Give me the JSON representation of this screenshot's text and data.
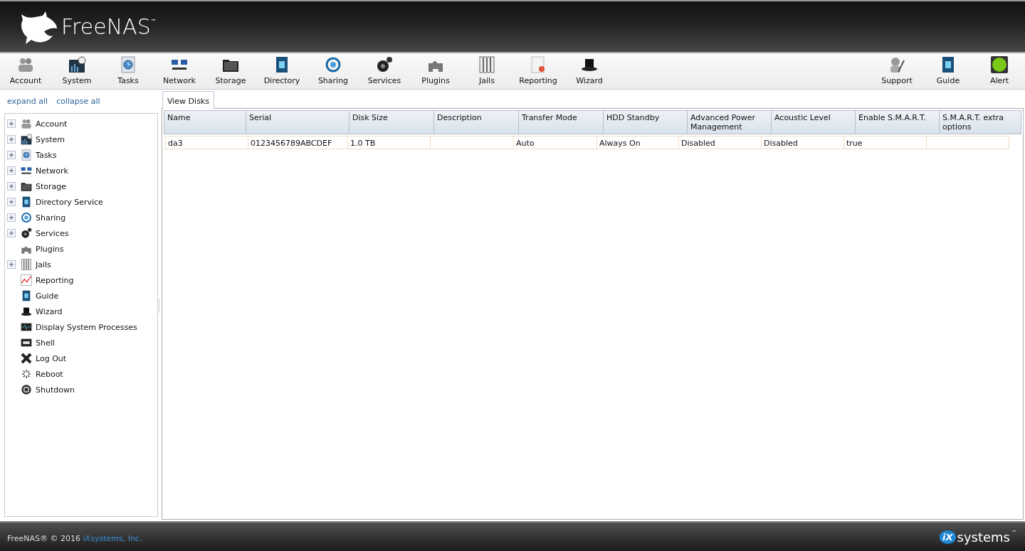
{
  "header": {
    "logo_text": "FreeNAS",
    "logo_mark": "™"
  },
  "toolbar": {
    "left": [
      {
        "label": "Account"
      },
      {
        "label": "System"
      },
      {
        "label": "Tasks"
      },
      {
        "label": "Network"
      },
      {
        "label": "Storage"
      },
      {
        "label": "Directory"
      },
      {
        "label": "Sharing"
      },
      {
        "label": "Services"
      },
      {
        "label": "Plugins"
      },
      {
        "label": "Jails"
      },
      {
        "label": "Reporting"
      },
      {
        "label": "Wizard"
      }
    ],
    "right": [
      {
        "label": "Support"
      },
      {
        "label": "Guide"
      },
      {
        "label": "Alert"
      }
    ]
  },
  "sidebar": {
    "expand_all": "expand all",
    "collapse_all": "collapse all",
    "items": [
      {
        "label": "Account",
        "expandable": true,
        "expanded": false
      },
      {
        "label": "System",
        "expandable": true,
        "expanded": false
      },
      {
        "label": "Tasks",
        "expandable": true,
        "expanded": false
      },
      {
        "label": "Network",
        "expandable": true,
        "expanded": false
      },
      {
        "label": "Storage",
        "expandable": true,
        "expanded": false
      },
      {
        "label": "Directory Service",
        "expandable": true,
        "expanded": false
      },
      {
        "label": "Sharing",
        "expandable": true,
        "expanded": false
      },
      {
        "label": "Services",
        "expandable": true,
        "expanded": false
      },
      {
        "label": "Plugins",
        "expandable": false
      },
      {
        "label": "Jails",
        "expandable": true,
        "expanded": false
      },
      {
        "label": "Reporting",
        "expandable": false
      },
      {
        "label": "Guide",
        "expandable": false
      },
      {
        "label": "Wizard",
        "expandable": false
      },
      {
        "label": "Display System Processes",
        "expandable": false
      },
      {
        "label": "Shell",
        "expandable": false
      },
      {
        "label": "Log Out",
        "expandable": false
      },
      {
        "label": "Reboot",
        "expandable": false
      },
      {
        "label": "Shutdown",
        "expandable": false
      }
    ]
  },
  "tabs": [
    {
      "label": "View Disks",
      "selected": true
    }
  ],
  "table": {
    "columns": [
      "Name",
      "Serial",
      "Disk Size",
      "Description",
      "Transfer Mode",
      "HDD Standby",
      "Advanced Power Management",
      "Acoustic Level",
      "Enable S.M.A.R.T.",
      "S.M.A.R.T. extra options"
    ],
    "rows": [
      [
        "da3",
        "0123456789ABCDEF",
        "1.0 TB",
        "",
        "Auto",
        "Always On",
        "Disabled",
        "Disabled",
        "true",
        ""
      ]
    ]
  },
  "footer": {
    "copyright": "FreeNAS® © 2016 ",
    "company_link": "iXsystems, Inc.",
    "brand_mark": "iX",
    "brand_text": "systems",
    "brand_tm": "™"
  }
}
